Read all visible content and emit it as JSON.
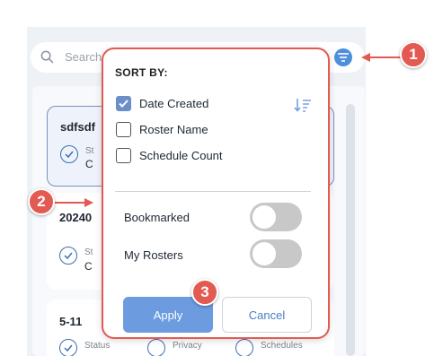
{
  "search": {
    "placeholder": "Search"
  },
  "rosters": [
    {
      "title": "sdfsdf",
      "status_label": "St",
      "status_value": "C"
    },
    {
      "title": "20240",
      "status_label": "St",
      "status_value": "C"
    },
    {
      "title": "5-11",
      "status_label": "Status",
      "privacy_label": "Privacy",
      "schedules_label": "Schedules"
    }
  ],
  "sort_popup": {
    "title": "SORT BY:",
    "options": [
      {
        "label": "Date Created",
        "checked": true
      },
      {
        "label": "Roster Name",
        "checked": false
      },
      {
        "label": "Schedule Count",
        "checked": false
      }
    ],
    "toggles": [
      {
        "label": "Bookmarked",
        "on": false
      },
      {
        "label": "My Rosters",
        "on": false
      }
    ],
    "apply_label": "Apply",
    "cancel_label": "Cancel"
  },
  "callouts": [
    "1",
    "2",
    "3"
  ],
  "colors": {
    "accent": "#4d8edd",
    "callout": "#e25a52",
    "apply": "#6c9be0"
  }
}
